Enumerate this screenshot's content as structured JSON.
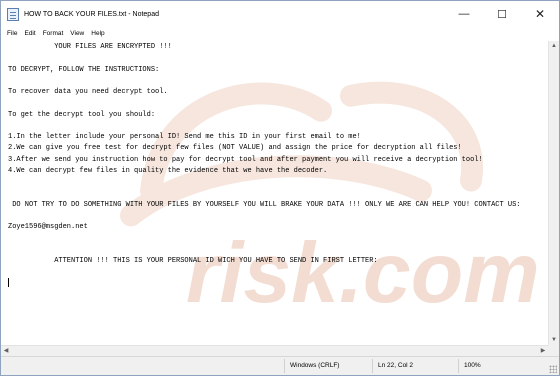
{
  "window": {
    "title": "HOW TO BACK YOUR FILES.txt - Notepad",
    "controls": {
      "minimize": "—",
      "maximize": "☐",
      "close": "✕"
    }
  },
  "menu": [
    "File",
    "Edit",
    "Format",
    "View",
    "Help"
  ],
  "document": {
    "lines": [
      "           YOUR FILES ARE ENCRYPTED !!!",
      "",
      "TO DECRYPT, FOLLOW THE INSTRUCTIONS:",
      "",
      "To recover data you need decrypt tool.",
      "",
      "To get the decrypt tool you should:",
      "",
      "1.In the letter include your personal ID! Send me this ID in your first email to me!",
      "2.We can give you free test for decrypt few files (NOT VALUE) and assign the price for decryption all files!",
      "3.After we send you instruction how to pay for decrypt tool and after payment you will receive a decryption tool!",
      "4.We can decrypt few files in quality the evidence that we have the decoder.",
      "",
      "",
      " DO NOT TRY TO DO SOMETHING WITH YOUR FILES BY YOURSELF YOU WILL BRAKE YOUR DATA !!! ONLY WE ARE CAN HELP YOU! CONTACT US:",
      "",
      "Zoye1596@msgden.net",
      "",
      "",
      "           ATTENTION !!! THIS IS YOUR PERSONAL ID WICH YOU HAVE TO SEND IN FIRST LETTER:",
      "",
      ""
    ]
  },
  "watermark": {
    "text": "risk.com",
    "color": "#f3ddd2"
  },
  "statusbar": {
    "encoding": "Windows (CRLF)",
    "position": "Ln 22, Col 2",
    "zoom": "100%"
  }
}
